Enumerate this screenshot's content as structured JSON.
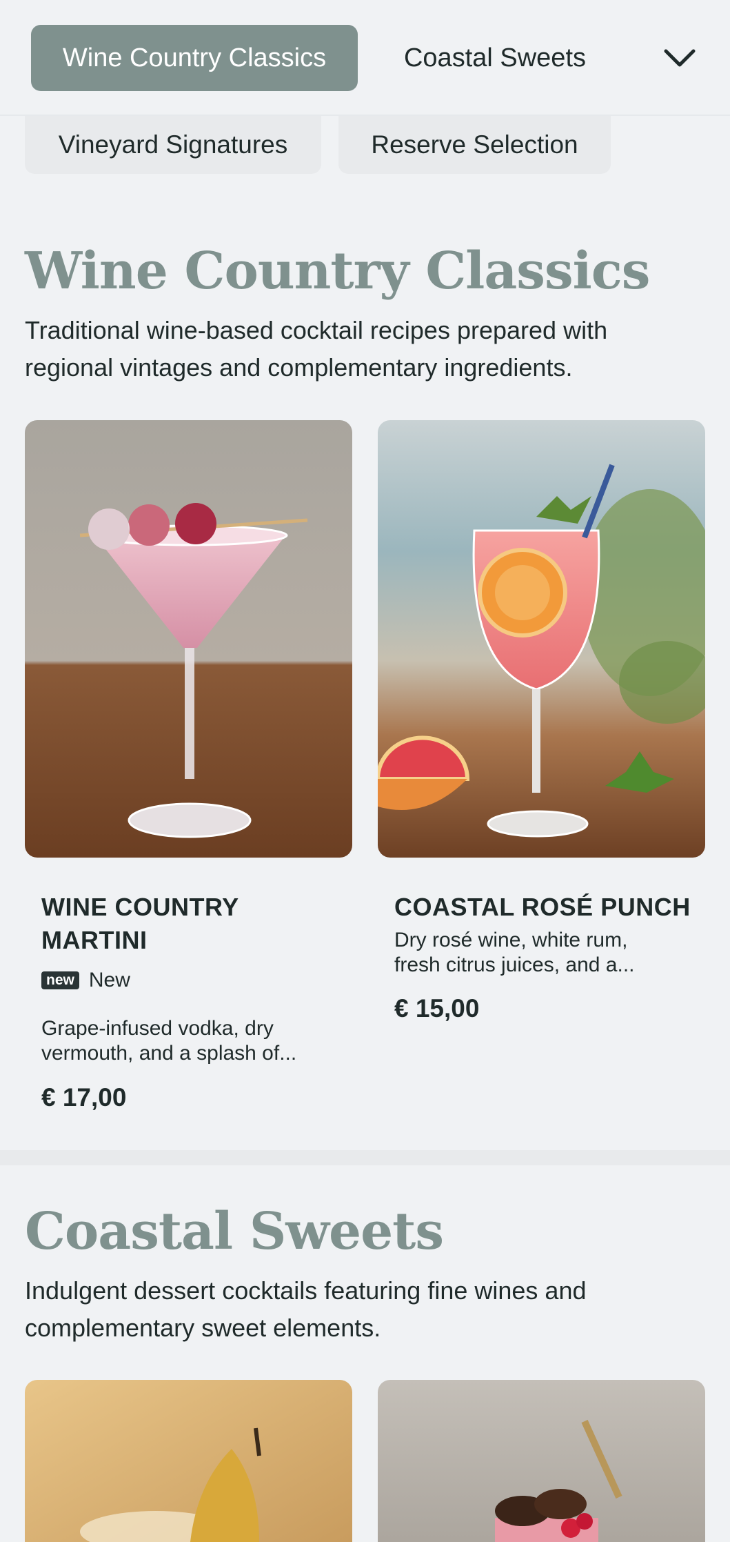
{
  "nav": {
    "tabs": [
      {
        "label": "Wine Country Classics",
        "active": true
      },
      {
        "label": "Coastal Sweets",
        "active": false
      },
      {
        "label": "Vineyard Signatures",
        "active": false
      },
      {
        "label": "Reserve Selection",
        "active": false
      }
    ],
    "more_icon": "chevron-down-icon"
  },
  "sections": [
    {
      "title": "Wine Country Classics",
      "description": "Traditional wine-based cocktail recipes prepared with regional vintages and complementary ingredients.",
      "items": [
        {
          "name_line1": "WINE COUNTRY",
          "name_line2": "MARTINI",
          "badge": "new",
          "badge_label": "New",
          "desc_line1": "Grape-infused vodka, dry",
          "desc_line2": "vermouth, and a splash of...",
          "price": "€ 17,00",
          "image": "pink-martini-with-grapes"
        },
        {
          "name_line1": "COASTAL ROSÉ PUNCH",
          "desc_line1": "Dry rosé wine, white rum,",
          "desc_line2": "fresh citrus juices, and a...",
          "price": "€ 15,00",
          "image": "rose-spritz-with-grapefruit"
        }
      ]
    },
    {
      "title": "Coastal Sweets",
      "description": "Indulgent dessert cocktails featuring fine wines and complementary sweet elements.",
      "items": [
        {
          "image": "pear-dessert-cocktail"
        },
        {
          "image": "chocolate-berry-cocktail"
        }
      ]
    }
  ],
  "colors": {
    "accent": "#7f918e",
    "background": "#f0f2f4",
    "text": "#1f2a2a",
    "badge": "#2a3435"
  }
}
